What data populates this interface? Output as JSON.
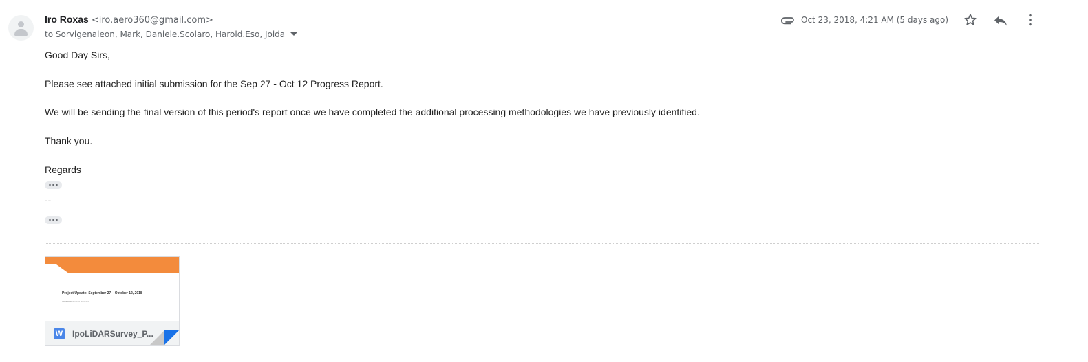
{
  "sender": {
    "name": "Iro Roxas",
    "email": "<iro.aero360@gmail.com>"
  },
  "recipients": "to Sorvigenaleon, Mark, Daniele.Scolaro, Harold.Eso, Joida",
  "date": "Oct 23, 2018, 4:21 AM (5 days ago)",
  "icons": {
    "avatar": "person-icon",
    "attachment": "paperclip-icon",
    "star": "star-icon",
    "reply": "reply-icon",
    "more": "more-vert-icon",
    "file_type": "word-icon"
  },
  "body": {
    "greeting": "Good Day Sirs,",
    "line1": "Please see attached initial submission for the Sep 27 - Oct 12 Progress Report.",
    "line2": "We will be sending the final version of this period's report once we have completed the additional processing methodologies we have previously identified.",
    "thanks": "Thank you.",
    "regards": "Regards",
    "separator": "--"
  },
  "attachment": {
    "preview_title": "Project Update: September 27 – October 12, 2018",
    "preview_subtitle": "CDRI DI Technical Library Inc.",
    "file_badge": "W",
    "file_name": "IpoLiDARSurvey_P..."
  },
  "colors": {
    "banner": "#f38b3c",
    "word_blue": "#4a86e8",
    "corner_blue": "#1a73e8",
    "meta_gray": "#5f6368"
  }
}
